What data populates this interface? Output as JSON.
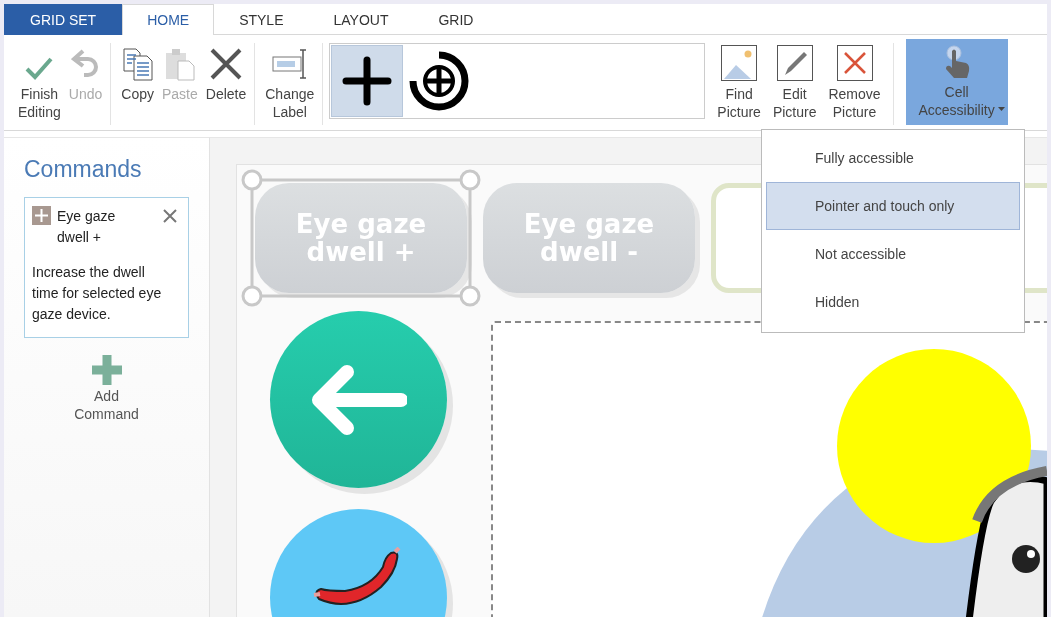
{
  "tabs": [
    {
      "label": "GRID SET",
      "kind": "backstage",
      "selected": false
    },
    {
      "label": "HOME",
      "kind": "tab",
      "selected": true
    },
    {
      "label": "STYLE",
      "kind": "tab",
      "selected": false
    },
    {
      "label": "LAYOUT",
      "kind": "tab",
      "selected": false
    },
    {
      "label": "GRID",
      "kind": "tab",
      "selected": false
    }
  ],
  "ribbon": {
    "groups": [
      [
        {
          "label": "Finish Editing",
          "disabled": false
        },
        {
          "label": "Undo",
          "disabled": true
        }
      ],
      [
        {
          "label": "Copy",
          "disabled": false
        },
        {
          "label": "Paste",
          "disabled": true
        },
        {
          "label": "Delete",
          "disabled": false
        }
      ],
      [
        {
          "label": "Change Label",
          "disabled": false
        }
      ]
    ],
    "symbols": [
      {
        "selected": true
      },
      {
        "selected": false
      }
    ],
    "picture_buttons": [
      {
        "label": "Find Picture"
      },
      {
        "label": "Edit Picture"
      },
      {
        "label": "Remove Picture"
      }
    ],
    "accessibility": {
      "label": "Cell Accessibility",
      "expanded": true
    }
  },
  "accessibility_menu": [
    {
      "label": "Fully accessible",
      "selected": false
    },
    {
      "label": "Pointer and touch only",
      "selected": true
    },
    {
      "label": "Not accessible",
      "selected": false
    },
    {
      "label": "Hidden",
      "selected": false
    }
  ],
  "sidebar": {
    "title": "Commands",
    "command": {
      "title": "Eye gaze dwell +",
      "description": "Increase the dwell time for selected eye gaze device."
    },
    "add_label": "Add Command"
  },
  "grid": {
    "cells": [
      {
        "kind": "label",
        "label": "Eye gaze dwell +",
        "selected": true
      },
      {
        "kind": "label",
        "label": "Eye gaze dwell -",
        "selected": false
      },
      {
        "kind": "empty",
        "selected": false
      },
      {
        "kind": "back",
        "selected": false
      },
      {
        "kind": "sausage",
        "selected": false
      },
      {
        "kind": "picture",
        "selected": false
      }
    ]
  }
}
